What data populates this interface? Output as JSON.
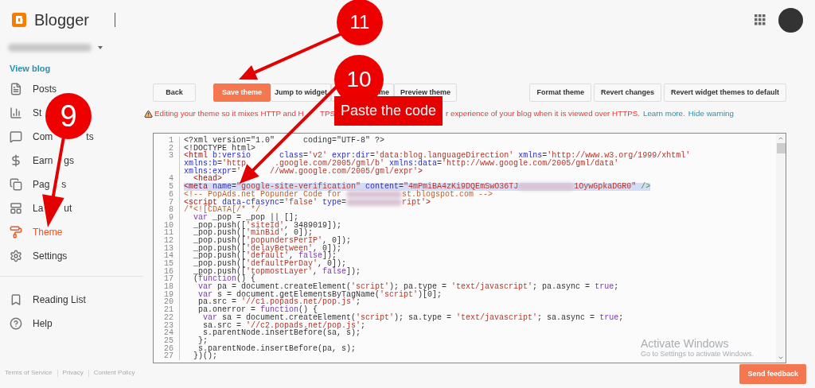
{
  "header": {
    "app_name": "Blogger"
  },
  "blog_switcher": {
    "link": "View blog"
  },
  "nav": [
    {
      "label_parts": [
        "Posts"
      ],
      "selected": false
    },
    {
      "label_parts": [
        "St"
      ],
      "selected": false
    },
    {
      "label_parts": [
        "Com",
        "ts"
      ],
      "selected": false
    },
    {
      "label_parts": [
        "Earn",
        "gs"
      ],
      "selected": false
    },
    {
      "label_parts": [
        "Pag",
        "s"
      ],
      "selected": false
    },
    {
      "label_parts": [
        "La",
        "ut"
      ],
      "selected": false
    },
    {
      "label_parts": [
        "Theme"
      ],
      "selected": true
    },
    {
      "label_parts": [
        "Settings"
      ],
      "selected": false
    }
  ],
  "nav_secondary": [
    {
      "label": "Reading List"
    },
    {
      "label": "Help"
    }
  ],
  "toolbar": {
    "left": [
      {
        "label": "Back",
        "primary": false
      },
      {
        "label": "Save theme",
        "primary": true
      },
      {
        "label": "Jump to widget",
        "primary": false
      },
      {
        "label": "me",
        "primary": false
      },
      {
        "label": "Preview theme",
        "primary": false
      }
    ],
    "right": [
      {
        "label": "Format theme",
        "primary": false
      },
      {
        "label": "Revert changes",
        "primary": false
      },
      {
        "label": "Revert widget themes to default",
        "primary": false
      }
    ]
  },
  "warning": {
    "parts": [
      "Editing your theme so it mixes HTTP and H",
      "TPS",
      "r experience of your blog when it is viewed over HTTPS."
    ],
    "links": [
      "Learn more.",
      "Hide warning"
    ]
  },
  "editor": {
    "rows": [
      {
        "number": "1",
        "highlighted": false,
        "segments": [
          {
            "kind": "plain",
            "text": "<?xml version=\"1.0\""
          },
          {
            "kind": "gap"
          },
          {
            "kind": "plain",
            "text": "coding=\"UTF-8\" ?>"
          }
        ]
      },
      {
        "number": "2",
        "highlighted": false,
        "segments": [
          {
            "kind": "plain",
            "text": "<!DOCTYPE html>"
          }
        ]
      },
      {
        "number": "3",
        "highlighted": false,
        "segments": [
          {
            "kind": "tag",
            "text": "<html "
          },
          {
            "kind": "attr",
            "text": "b:versio"
          },
          {
            "kind": "gap"
          },
          {
            "kind": "attr",
            "text": "class"
          },
          {
            "kind": "plain",
            "text": "="
          },
          {
            "kind": "string",
            "text": "'v2' "
          },
          {
            "kind": "attr",
            "text": "expr:dir"
          },
          {
            "kind": "plain",
            "text": "="
          },
          {
            "kind": "string",
            "text": "'data:blog.languageDirection' "
          },
          {
            "kind": "attr",
            "text": "xmlns"
          },
          {
            "kind": "plain",
            "text": "="
          },
          {
            "kind": "string",
            "text": "'http://www.w3.org/1999/xhtml'"
          }
        ]
      },
      {
        "highlighted": false,
        "segments": [
          {
            "kind": "attr",
            "text": "xmlns:b"
          },
          {
            "kind": "plain",
            "text": "="
          },
          {
            "kind": "string",
            "text": "'http"
          },
          {
            "kind": "gap"
          },
          {
            "kind": "string",
            "text": ".google.com/2005/gml/b' "
          },
          {
            "kind": "attr",
            "text": "xmlns:data"
          },
          {
            "kind": "plain",
            "text": "="
          },
          {
            "kind": "string",
            "text": "'http://www.google.com/2005/gml/data'"
          }
        ]
      },
      {
        "highlighted": false,
        "segments": [
          {
            "kind": "attr",
            "text": "xmlns:expr"
          },
          {
            "kind": "plain",
            "text": "="
          },
          {
            "kind": "string",
            "text": "'"
          },
          {
            "kind": "gap"
          },
          {
            "kind": "string",
            "text": "//www.google.com/2005/gml/expr'"
          },
          {
            "kind": "tag",
            "text": ">"
          }
        ]
      },
      {
        "number": "4",
        "highlighted": false,
        "segments": [
          {
            "kind": "tag",
            "text": "  <head>"
          }
        ]
      },
      {
        "number": "5",
        "highlighted": true,
        "segments": [
          {
            "kind": "tag",
            "text": "<meta "
          },
          {
            "kind": "attr",
            "text": "name"
          },
          {
            "kind": "plain",
            "text": "="
          },
          {
            "kind": "string",
            "text": "\"google-site-verification\" "
          },
          {
            "kind": "attr",
            "text": "content"
          },
          {
            "kind": "plain",
            "text": "="
          },
          {
            "kind": "string",
            "text": "\"4mPmiBA4zKi9DQEmSwO36TJ"
          },
          {
            "kind": "blur"
          },
          {
            "kind": "string",
            "text": "1OywGpkaDGR0\""
          },
          {
            "kind": "end",
            "text": " />"
          }
        ]
      },
      {
        "number": "6",
        "highlighted": false,
        "segments": [
          {
            "kind": "comment",
            "text": "<!-- PopAds.net Popunder Code for "
          },
          {
            "kind": "blur"
          },
          {
            "kind": "comment",
            "text": "st.blogspot.com -->"
          }
        ]
      },
      {
        "number": "7",
        "highlighted": false,
        "segments": [
          {
            "kind": "tag",
            "text": "<script "
          },
          {
            "kind": "attr",
            "text": "data-cfasync"
          },
          {
            "kind": "plain",
            "text": "="
          },
          {
            "kind": "string",
            "text": "'false' "
          },
          {
            "kind": "attr",
            "text": "type"
          },
          {
            "kind": "plain",
            "text": "="
          },
          {
            "kind": "blur"
          },
          {
            "kind": "string",
            "text": "ript'"
          },
          {
            "kind": "tag",
            "text": ">"
          }
        ]
      },
      {
        "number": "8",
        "highlighted": false,
        "segments": [
          {
            "kind": "comment",
            "text": "/*<![CDATA[/* */"
          }
        ]
      },
      {
        "number": "9",
        "highlighted": false,
        "segments": [
          {
            "kind": "keyword",
            "text": "  var"
          },
          {
            "kind": "plain",
            "text": " _pop = _pop || [];"
          }
        ]
      },
      {
        "number": "10",
        "highlighted": false,
        "segments": [
          {
            "kind": "plain",
            "text": "  _pop.push(["
          },
          {
            "kind": "jsstring",
            "text": "'siteId'"
          },
          {
            "kind": "plain",
            "text": ", 3489019]);"
          }
        ]
      },
      {
        "number": "11",
        "highlighted": false,
        "segments": [
          {
            "kind": "plain",
            "text": "  _pop.push(["
          },
          {
            "kind": "jsstring",
            "text": "'minBid'"
          },
          {
            "kind": "plain",
            "text": ", 0]);"
          }
        ]
      },
      {
        "number": "12",
        "highlighted": false,
        "segments": [
          {
            "kind": "plain",
            "text": "  _pop.push(["
          },
          {
            "kind": "jsstring",
            "text": "'popundersPerIP'"
          },
          {
            "kind": "plain",
            "text": ", 0]);"
          }
        ]
      },
      {
        "number": "13",
        "highlighted": false,
        "segments": [
          {
            "kind": "plain",
            "text": "  _pop.push(["
          },
          {
            "kind": "jsstring",
            "text": "'delayBetween'"
          },
          {
            "kind": "plain",
            "text": ", 0]);"
          }
        ]
      },
      {
        "number": "14",
        "highlighted": false,
        "segments": [
          {
            "kind": "plain",
            "text": "  _pop.push(["
          },
          {
            "kind": "jsstring",
            "text": "'default'"
          },
          {
            "kind": "plain",
            "text": ", "
          },
          {
            "kind": "keyword",
            "text": "false"
          },
          {
            "kind": "plain",
            "text": "]);"
          }
        ]
      },
      {
        "number": "15",
        "highlighted": false,
        "segments": [
          {
            "kind": "plain",
            "text": "  _pop.push(["
          },
          {
            "kind": "jsstring",
            "text": "'defaultPerDay'"
          },
          {
            "kind": "plain",
            "text": ", 0]);"
          }
        ]
      },
      {
        "number": "16",
        "highlighted": false,
        "segments": [
          {
            "kind": "plain",
            "text": "  _pop.push(["
          },
          {
            "kind": "jsstring",
            "text": "'topmostLayer'"
          },
          {
            "kind": "plain",
            "text": ", "
          },
          {
            "kind": "keyword",
            "text": "false"
          },
          {
            "kind": "plain",
            "text": "]);"
          }
        ]
      },
      {
        "number": "17",
        "highlighted": false,
        "segments": [
          {
            "kind": "plain",
            "text": "  ("
          },
          {
            "kind": "keyword",
            "text": "function"
          },
          {
            "kind": "plain",
            "text": "() {"
          }
        ]
      },
      {
        "number": "18",
        "highlighted": false,
        "segments": [
          {
            "kind": "keyword",
            "text": "   var"
          },
          {
            "kind": "plain",
            "text": " pa = document.createElement("
          },
          {
            "kind": "jsstring",
            "text": "'script'"
          },
          {
            "kind": "plain",
            "text": "); pa.type = "
          },
          {
            "kind": "jsstring",
            "text": "'text/javascript'"
          },
          {
            "kind": "plain",
            "text": "; pa.async = "
          },
          {
            "kind": "keyword",
            "text": "true"
          },
          {
            "kind": "plain",
            "text": ";"
          }
        ]
      },
      {
        "number": "19",
        "highlighted": false,
        "segments": [
          {
            "kind": "keyword",
            "text": "   var"
          },
          {
            "kind": "plain",
            "text": " s = document.getElementsByTagName("
          },
          {
            "kind": "jsstring",
            "text": "'script'"
          },
          {
            "kind": "plain",
            "text": ")[0];"
          }
        ]
      },
      {
        "number": "20",
        "highlighted": false,
        "segments": [
          {
            "kind": "plain",
            "text": "   pa.src = "
          },
          {
            "kind": "jsstring",
            "text": "'//c1.popads.net/pop.js'"
          },
          {
            "kind": "plain",
            "text": ";"
          }
        ]
      },
      {
        "number": "21",
        "highlighted": false,
        "segments": [
          {
            "kind": "plain",
            "text": "   pa.onerror = "
          },
          {
            "kind": "keyword",
            "text": "function"
          },
          {
            "kind": "plain",
            "text": "() {"
          }
        ]
      },
      {
        "number": "22",
        "highlighted": false,
        "segments": [
          {
            "kind": "keyword",
            "text": "    var"
          },
          {
            "kind": "plain",
            "text": " sa = document.createElement("
          },
          {
            "kind": "jsstring",
            "text": "'script'"
          },
          {
            "kind": "plain",
            "text": "); sa.type = "
          },
          {
            "kind": "jsstring",
            "text": "'text/javascript'"
          },
          {
            "kind": "plain",
            "text": "; sa.async = "
          },
          {
            "kind": "keyword",
            "text": "true"
          },
          {
            "kind": "plain",
            "text": ";"
          }
        ]
      },
      {
        "number": "23",
        "highlighted": false,
        "segments": [
          {
            "kind": "plain",
            "text": "    sa.src = "
          },
          {
            "kind": "jsstring",
            "text": "'//c2.popads.net/pop.js'"
          },
          {
            "kind": "plain",
            "text": ";"
          }
        ]
      },
      {
        "number": "24",
        "highlighted": false,
        "segments": [
          {
            "kind": "plain",
            "text": "    s.parentNode.insertBefore(sa, s);"
          }
        ]
      },
      {
        "number": "25",
        "highlighted": false,
        "segments": [
          {
            "kind": "plain",
            "text": "   };"
          }
        ]
      },
      {
        "number": "26",
        "highlighted": false,
        "segments": [
          {
            "kind": "plain",
            "text": "   s.parentNode.insertBefore(pa, s);"
          }
        ]
      },
      {
        "number": "27",
        "highlighted": false,
        "segments": [
          {
            "kind": "plain",
            "text": "  })();"
          }
        ]
      }
    ]
  },
  "os_notice": {
    "title": "Activate Windows",
    "subtitle": "Go to Settings to activate Windows."
  },
  "footer": {
    "links": [
      "Terms of Service",
      "Privacy",
      "Content Policy"
    ]
  },
  "feedback_button": "Send feedback",
  "annotations": {
    "steps": [
      {
        "number": "9"
      },
      {
        "number": "10"
      },
      {
        "number": "11"
      }
    ],
    "callout": "Paste the code"
  }
}
